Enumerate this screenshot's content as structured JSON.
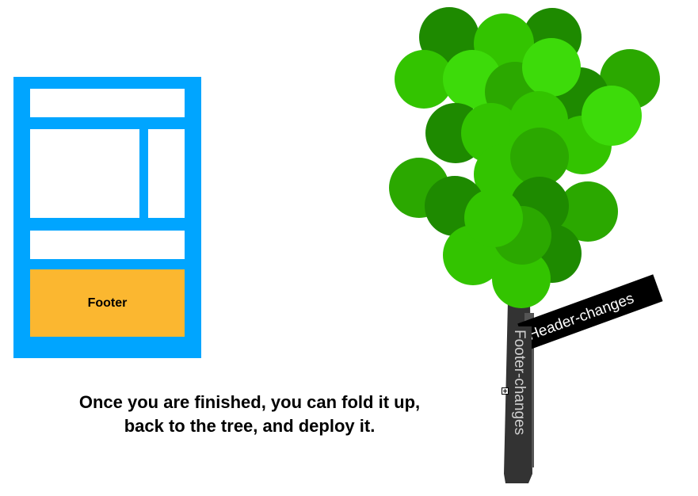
{
  "layout": {
    "footer_label": "Footer"
  },
  "caption": {
    "line1": "Once you are finished, you can fold it up,",
    "line2": "back to the tree, and deploy it."
  },
  "tree": {
    "branches": [
      {
        "label": "Header-changes",
        "color": "#000000"
      },
      {
        "label": "Footer-changes",
        "color": "#333333"
      }
    ],
    "trunk_color": "#333333",
    "foliage_colors": [
      "#1E8A00",
      "#2BA800",
      "#33C400",
      "#3DDB0A"
    ]
  },
  "colors": {
    "frame": "#00A5FF",
    "footer": "#FBB730",
    "background": "#FFFFFF"
  }
}
